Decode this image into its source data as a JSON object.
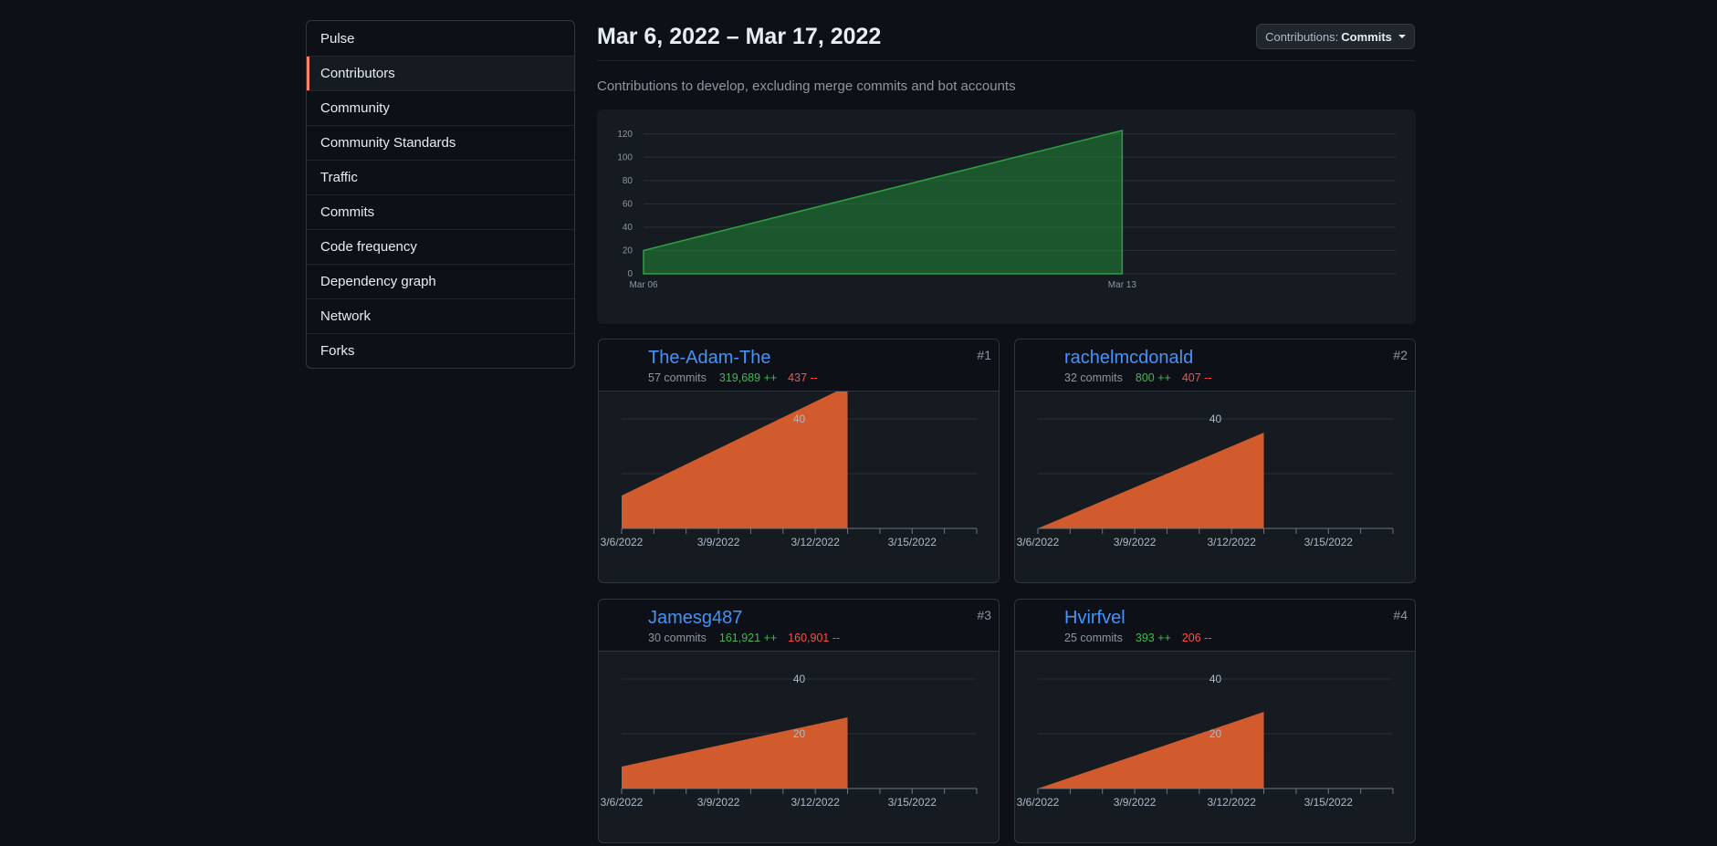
{
  "sidebar": {
    "items": [
      {
        "label": "Pulse"
      },
      {
        "label": "Contributors",
        "active": true
      },
      {
        "label": "Community"
      },
      {
        "label": "Community Standards"
      },
      {
        "label": "Traffic"
      },
      {
        "label": "Commits"
      },
      {
        "label": "Code frequency"
      },
      {
        "label": "Dependency graph"
      },
      {
        "label": "Network"
      },
      {
        "label": "Forks"
      }
    ]
  },
  "header": {
    "date_range": "Mar 6, 2022 – Mar 17, 2022",
    "contrib_prefix": "Contributions:",
    "contrib_value": "Commits",
    "subtitle": "Contributions to develop, excluding merge commits and bot accounts"
  },
  "colors": {
    "accent_active": "#f78166",
    "main_area": "#238636",
    "card_area": "#d15b2c",
    "link": "#4493f8",
    "additions": "#3fb950",
    "deletions": "#f85149"
  },
  "contributors": [
    {
      "name": "The-Adam-The",
      "rank": "#1",
      "commits": "57 commits",
      "additions": "319,689 ++",
      "deletions": "437 --",
      "avatar_icon": "avatar-photo-icon"
    },
    {
      "name": "rachelmcdonald",
      "rank": "#2",
      "commits": "32 commits",
      "additions": "800 ++",
      "deletions": "407 --",
      "avatar_icon": "avatar-photo-icon"
    },
    {
      "name": "Jamesg487",
      "rank": "#3",
      "commits": "30 commits",
      "additions": "161,921 ++",
      "deletions": "160,901 --",
      "avatar_icon": "avatar-photo-icon"
    },
    {
      "name": "Hvirfvel",
      "rank": "#4",
      "commits": "25 commits",
      "additions": "393 ++",
      "deletions": "206 --",
      "avatar_icon": "avatar-identicon-icon"
    }
  ],
  "chart_data": [
    {
      "type": "area",
      "x": [
        "Mar 06",
        "Mar 13"
      ],
      "values": [
        20,
        123
      ],
      "xticks": [
        "Mar 06",
        "Mar 13"
      ],
      "yticks": [
        0,
        20,
        40,
        60,
        80,
        100,
        120
      ],
      "ylim": [
        0,
        130
      ],
      "grid": true
    },
    {
      "type": "area",
      "series": [
        {
          "name": "The-Adam-The",
          "values": [
            12,
            52
          ]
        }
      ],
      "x": [
        "3/6/2022",
        "3/13/2022"
      ],
      "xticks": [
        "3/6/2022",
        "3/9/2022",
        "3/12/2022",
        "3/15/2022"
      ],
      "yticks": [
        40
      ],
      "ylim": [
        0,
        50
      ]
    },
    {
      "type": "area",
      "series": [
        {
          "name": "rachelmcdonald",
          "values": [
            0,
            35
          ]
        }
      ],
      "x": [
        "3/6/2022",
        "3/13/2022"
      ],
      "xticks": [
        "3/6/2022",
        "3/9/2022",
        "3/12/2022",
        "3/15/2022"
      ],
      "yticks": [
        40
      ],
      "ylim": [
        0,
        50
      ]
    },
    {
      "type": "area",
      "series": [
        {
          "name": "Jamesg487",
          "values": [
            8,
            26
          ]
        }
      ],
      "x": [
        "3/6/2022",
        "3/13/2022"
      ],
      "xticks": [
        "3/6/2022",
        "3/9/2022",
        "3/12/2022",
        "3/15/2022"
      ],
      "yticks": [
        20,
        40
      ],
      "ylim": [
        0,
        50
      ]
    },
    {
      "type": "area",
      "series": [
        {
          "name": "Hvirfvel",
          "values": [
            0,
            28
          ]
        }
      ],
      "x": [
        "3/6/2022",
        "3/13/2022"
      ],
      "xticks": [
        "3/6/2022",
        "3/9/2022",
        "3/12/2022",
        "3/15/2022"
      ],
      "yticks": [
        20,
        40
      ],
      "ylim": [
        0,
        50
      ]
    }
  ]
}
